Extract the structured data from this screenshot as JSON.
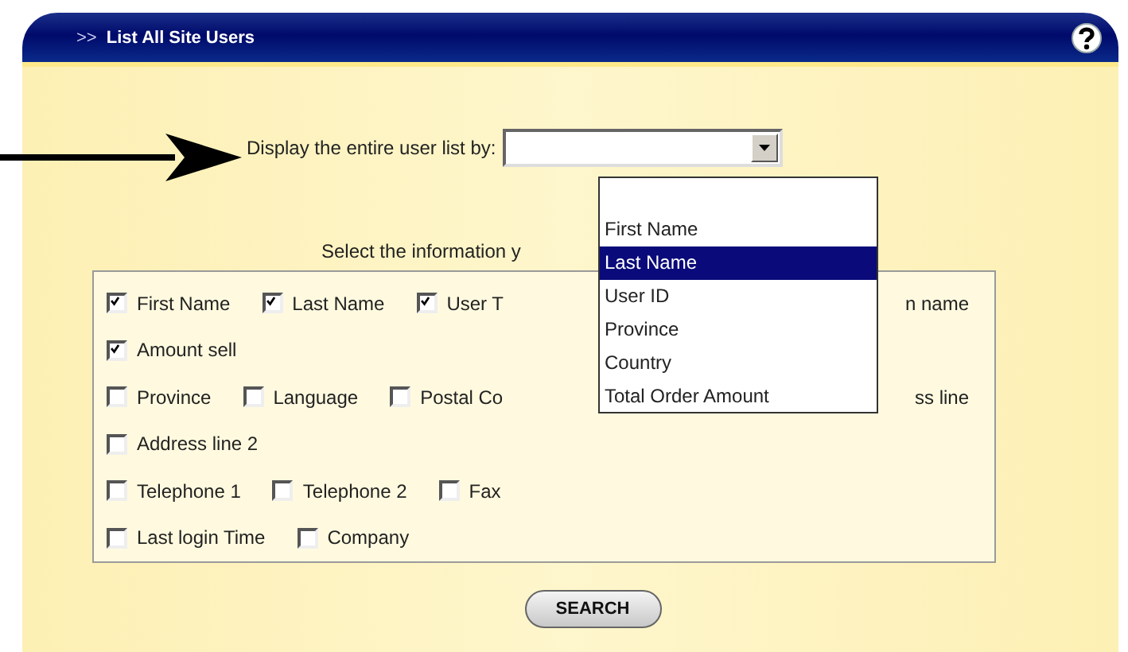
{
  "header": {
    "prefix": ">>",
    "title": "List All Site Users"
  },
  "display_by": {
    "label": "Display the entire user list by:",
    "options": [
      {
        "label": "First Name",
        "selected": false
      },
      {
        "label": "Last Name",
        "selected": true
      },
      {
        "label": "User ID",
        "selected": false
      },
      {
        "label": "Province",
        "selected": false
      },
      {
        "label": "Country",
        "selected": false
      },
      {
        "label": "Total Order Amount",
        "selected": false
      }
    ]
  },
  "info_prompt": "Select the information y",
  "field_rows": [
    [
      {
        "kind": "checkbox",
        "label": "First Name",
        "checked": true
      },
      {
        "kind": "checkbox",
        "label": "Last Name",
        "checked": true
      },
      {
        "kind": "checkbox",
        "label": "User T",
        "checked": true
      },
      {
        "kind": "fragment",
        "label": "n name"
      }
    ],
    [
      {
        "kind": "checkbox",
        "label": "Amount sell",
        "checked": true
      }
    ],
    [
      {
        "kind": "checkbox",
        "label": "Province",
        "checked": false
      },
      {
        "kind": "checkbox",
        "label": "Language",
        "checked": false
      },
      {
        "kind": "checkbox",
        "label": "Postal Co",
        "checked": false
      },
      {
        "kind": "fragment",
        "label": "ss line"
      }
    ],
    [
      {
        "kind": "checkbox",
        "label": "Address line 2",
        "checked": false
      }
    ],
    [
      {
        "kind": "checkbox",
        "label": "Telephone 1",
        "checked": false
      },
      {
        "kind": "checkbox",
        "label": "Telephone 2",
        "checked": false
      },
      {
        "kind": "checkbox",
        "label": "Fax",
        "checked": false
      }
    ],
    [
      {
        "kind": "checkbox",
        "label": "Last login Time",
        "checked": false
      },
      {
        "kind": "checkbox",
        "label": "Company",
        "checked": false
      }
    ]
  ],
  "search_button": "SEARCH"
}
